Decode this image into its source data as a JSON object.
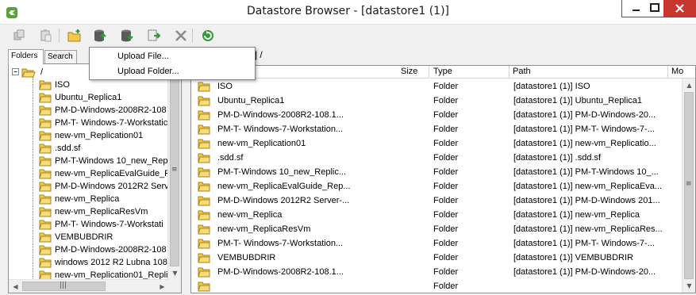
{
  "window": {
    "title": "Datastore Browser - [datastore1 (1)]",
    "controls": [
      "minimize",
      "maximize",
      "close"
    ]
  },
  "toolbar": {
    "buttons": [
      {
        "name": "copy-icon",
        "tooltip": ""
      },
      {
        "name": "paste-icon",
        "tooltip": ""
      },
      {
        "name": "new-folder-icon",
        "tooltip": ""
      },
      {
        "name": "upload-icon",
        "tooltip": ""
      },
      {
        "name": "download-icon",
        "tooltip": ""
      },
      {
        "name": "register-vm-icon",
        "tooltip": ""
      },
      {
        "name": "delete-icon",
        "tooltip": ""
      },
      {
        "name": "refresh-icon",
        "tooltip": ""
      }
    ]
  },
  "upload_menu": {
    "items": [
      "Upload File...",
      "Upload Folder..."
    ]
  },
  "left_panel": {
    "tabs": [
      "Folders",
      "Search"
    ],
    "root_label": "/",
    "tree_items": [
      "ISO",
      "Ubuntu_Replica1",
      "PM-D-Windows-2008R2-108",
      "PM-T- Windows-7-Workstatic",
      "new-vm_Replication01",
      ".sdd.sf",
      "PM-T-Windows 10_new_Rep",
      "new-vm_ReplicaEvalGuide_R",
      "PM-D-Windows 2012R2 Serv",
      "new-vm_Replica",
      "new-vm_ReplicaResVm",
      "PM-T- Windows-7-Workstati",
      "VEMBUBDRIR",
      "PM-D-Windows-2008R2-108",
      "windows 2012 R2 Lubna 108",
      "new-vm_Replication01_Repli"
    ]
  },
  "right_panel": {
    "path_label": "0] /",
    "columns": [
      "Size",
      "Type",
      "Path",
      "Mo"
    ],
    "rows": [
      {
        "name": "ISO",
        "type": "Folder",
        "path": "[datastore1 (1)] ISO"
      },
      {
        "name": "Ubuntu_Replica1",
        "type": "Folder",
        "path": "[datastore1 (1)] Ubuntu_Replica1"
      },
      {
        "name": "PM-D-Windows-2008R2-108.1...",
        "type": "Folder",
        "path": "[datastore1 (1)] PM-D-Windows-20..."
      },
      {
        "name": "PM-T- Windows-7-Workstation...",
        "type": "Folder",
        "path": "[datastore1 (1)] PM-T- Windows-7-..."
      },
      {
        "name": "new-vm_Replication01",
        "type": "Folder",
        "path": "[datastore1 (1)] new-vm_Replicatio..."
      },
      {
        "name": ".sdd.sf",
        "type": "Folder",
        "path": "[datastore1 (1)] .sdd.sf"
      },
      {
        "name": "PM-T-Windows 10_new_Replic...",
        "type": "Folder",
        "path": "[datastore1 (1)] PM-T-Windows 10_..."
      },
      {
        "name": "new-vm_ReplicaEvalGuide_Rep...",
        "type": "Folder",
        "path": "[datastore1 (1)] new-vm_ReplicaEva..."
      },
      {
        "name": "PM-D-Windows 2012R2 Server-...",
        "type": "Folder",
        "path": "[datastore1 (1)] PM-D-Windows 201..."
      },
      {
        "name": "new-vm_Replica",
        "type": "Folder",
        "path": "[datastore1 (1)] new-vm_Replica"
      },
      {
        "name": "new-vm_ReplicaResVm",
        "type": "Folder",
        "path": "[datastore1 (1)] new-vm_ReplicaRes..."
      },
      {
        "name": "PM-T- Windows-7-Workstation...",
        "type": "Folder",
        "path": "[datastore1 (1)] PM-T- Windows-7-..."
      },
      {
        "name": "VEMBUBDRIR",
        "type": "Folder",
        "path": "[datastore1 (1)] VEMBUBDRIR"
      },
      {
        "name": "PM-D-Windows-2008R2-108.1...",
        "type": "Folder",
        "path": "[datastore1 (1)] PM-D-Windows-20..."
      },
      {
        "name": "",
        "type": "Folder",
        "path": ""
      }
    ]
  },
  "colors": {
    "close_button": "#c7372f",
    "folder_yellow": "#f2c94c",
    "folder_dark": "#d8a21d",
    "refresh_green": "#2e9b33"
  }
}
